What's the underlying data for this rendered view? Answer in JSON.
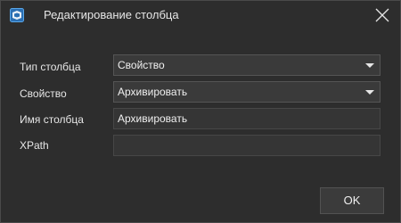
{
  "window": {
    "title": "Редактирование столбца",
    "app_icon": "app-logo-icon",
    "close_icon": "close-icon"
  },
  "form": {
    "column_type": {
      "label": "Тип столбца",
      "value": "Свойство"
    },
    "property": {
      "label": "Свойство",
      "value": "Архивировать"
    },
    "column_name": {
      "label": "Имя столбца",
      "value": "Архивировать"
    },
    "xpath": {
      "label": "XPath",
      "value": ""
    }
  },
  "buttons": {
    "ok_label": "OK"
  },
  "colors": {
    "background": "#2d2d2d",
    "field": "#383838",
    "text": "#e6e6e6",
    "icon_accent": "#3a8fd6"
  }
}
